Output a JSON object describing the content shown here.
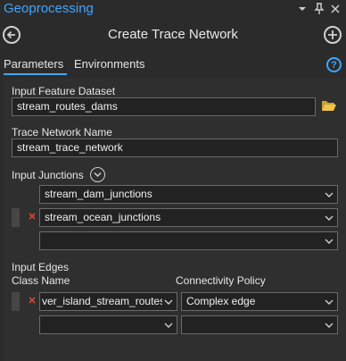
{
  "pane": {
    "title": "Geoprocessing"
  },
  "tool": {
    "title": "Create Trace Network"
  },
  "tabs": {
    "parameters": "Parameters",
    "environments": "Environments"
  },
  "params": {
    "input_dataset": {
      "label": "Input Feature Dataset",
      "value": "stream_routes_dams"
    },
    "network_name": {
      "label": "Trace Network Name",
      "value": "stream_trace_network"
    },
    "junctions": {
      "label": "Input Junctions",
      "rows": [
        "stream_dam_junctions",
        "stream_ocean_junctions",
        ""
      ]
    },
    "edges": {
      "label": "Input Edges",
      "col_class": "Class Name",
      "col_policy": "Connectivity Policy",
      "rows": [
        {
          "class_name": "ver_island_stream_routes",
          "policy": "Complex edge"
        },
        {
          "class_name": "",
          "policy": ""
        }
      ]
    }
  },
  "colors": {
    "accent": "#3fa6ff",
    "remove": "#e04a3a",
    "background": "#2b2b2b"
  },
  "icons": [
    "back-icon",
    "add-icon",
    "help-icon",
    "folder-icon",
    "chevron-down-icon",
    "close-icon",
    "pin-icon"
  ]
}
